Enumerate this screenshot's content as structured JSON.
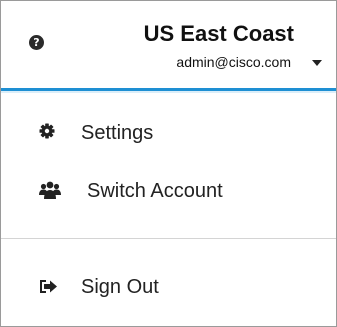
{
  "header": {
    "account_name": "US East Coast",
    "user_email": "admin@cisco.com",
    "help_icon": "question-circle-icon",
    "dropdown_icon": "caret-down-icon",
    "help_glyph": "?"
  },
  "menu": {
    "items": [
      {
        "label": "Settings",
        "icon": "gear-icon"
      },
      {
        "label": "Switch Account",
        "icon": "users-icon"
      },
      {
        "label": "Sign Out",
        "icon": "sign-out-icon"
      }
    ]
  },
  "colors": {
    "accent": "#1e8fd3",
    "text": "#222222",
    "border": "#9a9a9a",
    "divider": "#d4d4d4"
  }
}
